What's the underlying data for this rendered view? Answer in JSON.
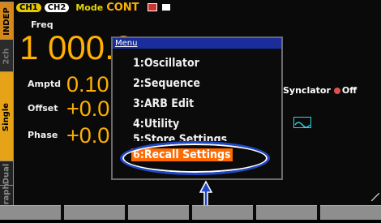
{
  "side_tabs": {
    "indep": "INDEP",
    "ch": "2ch",
    "single": "Single",
    "dual": "Dual",
    "graph": "Graph"
  },
  "top": {
    "ch1": "CH1",
    "ch2": "CH2",
    "mode_label": "Mode",
    "mode_value": "CONT"
  },
  "params": {
    "freq_label": "Freq",
    "freq_value": "1 000.0",
    "amptd_label": "Amptd",
    "amptd_value": "0.10",
    "offset_label": "Offset",
    "offset_value": "+0.0",
    "phase_label": "Phase",
    "phase_value": "+0.0"
  },
  "sync": {
    "label": "Synclator",
    "value": "Off"
  },
  "menu": {
    "title": "Menu",
    "items": [
      {
        "num": "1:",
        "label": "Oscillator"
      },
      {
        "num": "2:",
        "label": "Sequence"
      },
      {
        "num": "3:",
        "label": "ARB Edit"
      },
      {
        "num": "4:",
        "label": "Utility"
      },
      {
        "num": "5:",
        "label": "Store Settings"
      },
      {
        "num": "6:",
        "label": "Recall Settings"
      }
    ],
    "selected_index": 5
  },
  "colors": {
    "accent": "#ffb000",
    "menu_title_bg": "#1a2d9a",
    "selection": "#ff6a00",
    "highlight_ring": "#1f48c8"
  },
  "icons": {
    "wave": "sine-wave-icon",
    "arrow": "pointer-arrow-icon"
  }
}
